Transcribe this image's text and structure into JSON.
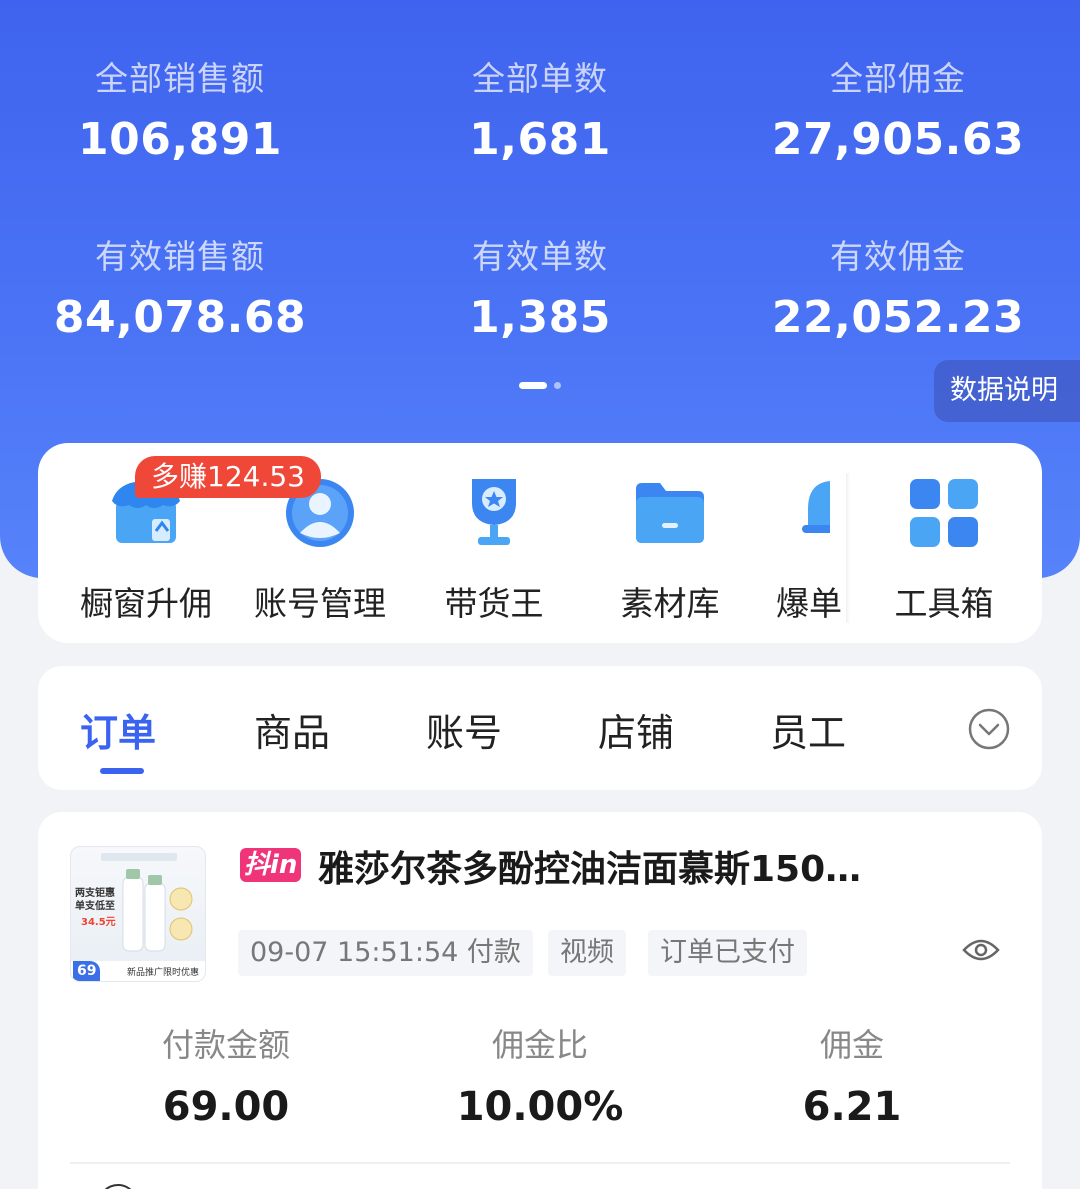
{
  "stats": [
    {
      "label": "全部销售额",
      "value": "106,891"
    },
    {
      "label": "全部单数",
      "value": "1,681"
    },
    {
      "label": "全部佣金",
      "value": "27,905.63"
    },
    {
      "label": "有效销售额",
      "value": "84,078.68"
    },
    {
      "label": "有效单数",
      "value": "1,385"
    },
    {
      "label": "有效佣金",
      "value": "22,052.23"
    }
  ],
  "data_note_label": "数据说明",
  "extra_earn_badge": "多赚124.53",
  "tools": [
    {
      "label": "橱窗升佣",
      "icon": "storefront-icon"
    },
    {
      "label": "账号管理",
      "icon": "user-account-icon"
    },
    {
      "label": "带货王",
      "icon": "trophy-icon"
    },
    {
      "label": "素材库",
      "icon": "folder-icon"
    },
    {
      "label": "爆单",
      "icon": "bell-icon"
    },
    {
      "label": "工具箱",
      "icon": "grid-icon"
    }
  ],
  "tabs": [
    {
      "label": "订单",
      "active": true
    },
    {
      "label": "商品",
      "active": false
    },
    {
      "label": "账号",
      "active": false
    },
    {
      "label": "店铺",
      "active": false
    },
    {
      "label": "员工",
      "active": false
    }
  ],
  "order": {
    "platform_badge": "抖in",
    "title": "雅莎尔茶多酚控油洁面慕斯150…",
    "thumbnail": {
      "caption_line1": "两支钜惠",
      "caption_line2": "单支低至",
      "caption_price": "34.5元",
      "price_tag": "69",
      "promo_text": "新品推广限时优惠"
    },
    "chips": [
      "09-07 15:51:54 付款",
      "视频",
      "订单已支付"
    ],
    "metrics": [
      {
        "label": "付款金额",
        "value": "69.00"
      },
      {
        "label": "佣金比",
        "value": "10.00%"
      },
      {
        "label": "佣金",
        "value": "6.21"
      }
    ]
  },
  "colors": {
    "hero_blue": "#4a73f5",
    "accent_blue": "#3a63f0",
    "badge_red": "#f04838",
    "douyin_pink": "#f0347a"
  }
}
